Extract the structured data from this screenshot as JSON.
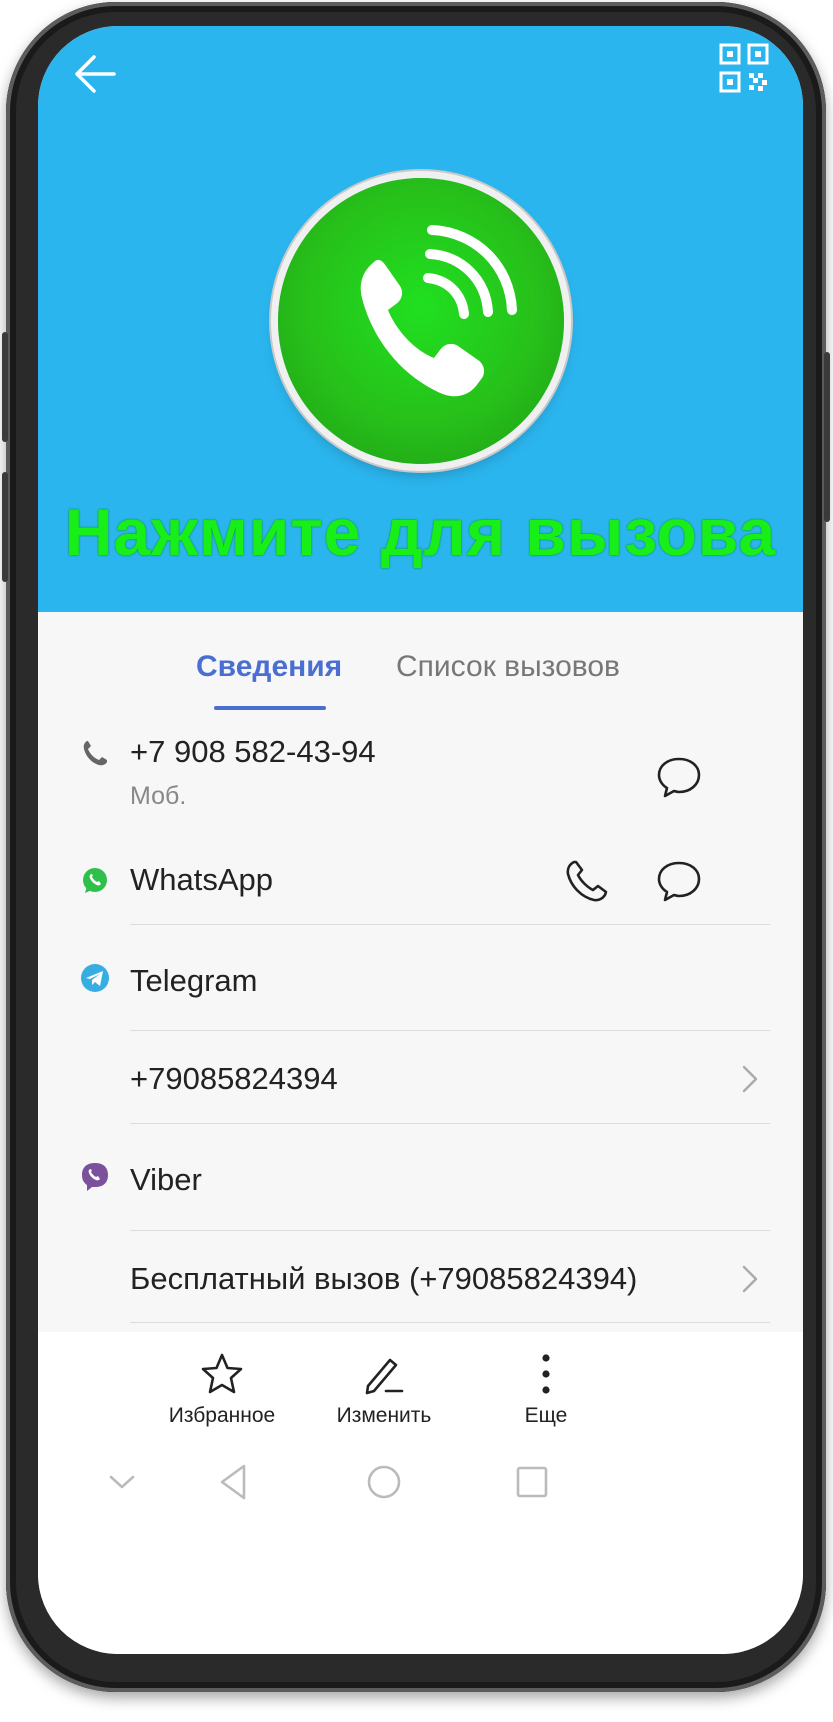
{
  "header": {
    "background": "#2bb5ee",
    "back_icon": "arrow-left-icon",
    "qr_icon": "qr-code-icon",
    "call_icon": "phone-call-icon",
    "call_text": "Нажмите для вызова",
    "call_text_color": "#18ef18"
  },
  "tabs": {
    "details": "Сведения",
    "call_log": "Список вызовов",
    "accent": "#4a6fd1"
  },
  "contact": {
    "phone": {
      "number": "+7 908 582-43-94",
      "type": "Моб."
    },
    "whatsapp": {
      "label": "WhatsApp",
      "icon": "whatsapp-icon"
    },
    "telegram": {
      "label": "Telegram",
      "icon": "telegram-icon",
      "entry": "+79085824394"
    },
    "viber": {
      "label": "Viber",
      "icon": "viber-icon",
      "entry": "Бесплатный вызов (+79085824394)"
    }
  },
  "toolbar": {
    "favorites": "Избранное",
    "edit": "Изменить",
    "more": "Еще"
  }
}
